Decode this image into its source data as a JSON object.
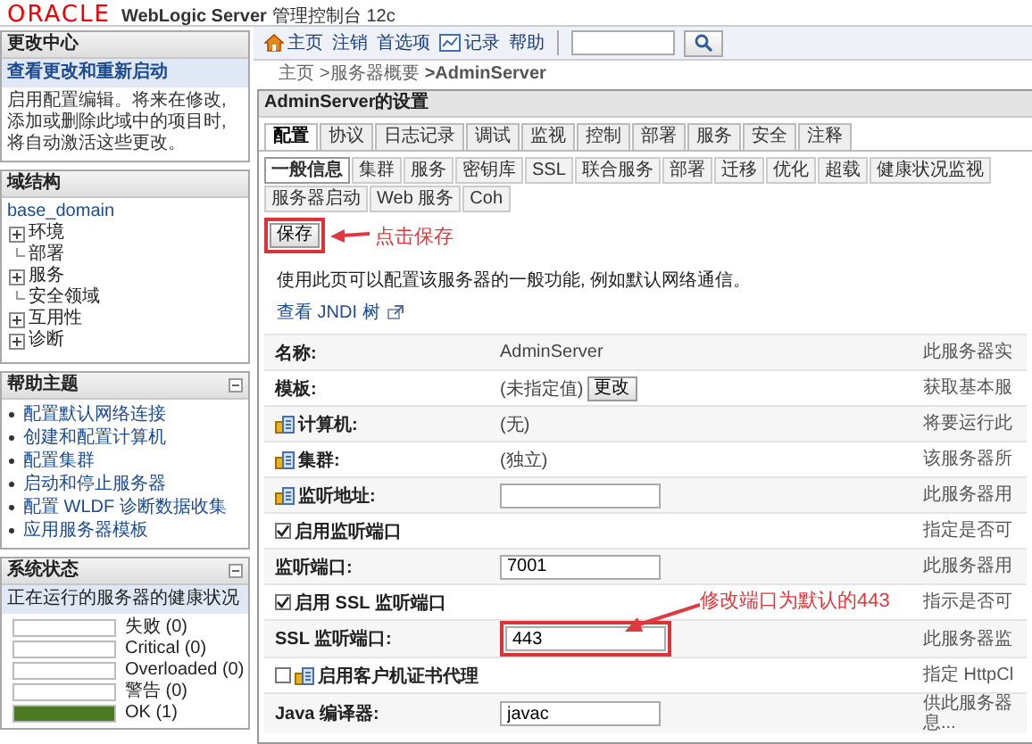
{
  "header": {
    "logo": "ORACLE",
    "product": "WebLogic Server",
    "subtitle": "管理控制台 12c"
  },
  "change_center": {
    "title": "更改中心",
    "link": "查看更改和重新启动",
    "text": "启用配置编辑。将来在修改, 添加或删除此域中的项目时, 将自动激活这些更改。"
  },
  "domain_structure": {
    "title": "域结构",
    "tree": [
      {
        "label": "base_domain",
        "kind": "root",
        "children": [
          {
            "label": "环境",
            "kind": "expandable"
          },
          {
            "label": "部署",
            "kind": "leaf"
          },
          {
            "label": "服务",
            "kind": "expandable"
          },
          {
            "label": "安全领域",
            "kind": "leaf"
          },
          {
            "label": "互用性",
            "kind": "expandable"
          },
          {
            "label": "诊断",
            "kind": "expandable"
          }
        ]
      }
    ]
  },
  "help_topics": {
    "title": "帮助主题",
    "items": [
      "配置默认网络连接",
      "创建和配置计算机",
      "配置集群",
      "启动和停止服务器",
      "配置 WLDF 诊断数据收集",
      "应用服务器模板"
    ]
  },
  "system_status": {
    "title": "系统状态",
    "subtitle": "正在运行的服务器的健康状况",
    "items": [
      {
        "label": "失败 (0)",
        "level": 0
      },
      {
        "label": "Critical (0)",
        "level": 0
      },
      {
        "label": "Overloaded (0)",
        "level": 0
      },
      {
        "label": "警告 (0)",
        "level": 0
      },
      {
        "label": "OK (1)",
        "level": 1
      }
    ]
  },
  "toolbar": {
    "links": [
      {
        "label": "主页",
        "kind": "home"
      },
      {
        "label": "注销",
        "kind": "plain"
      },
      {
        "label": "首选项",
        "kind": "plain"
      },
      {
        "label": "记录",
        "kind": "chart"
      },
      {
        "label": "帮助",
        "kind": "plain"
      }
    ]
  },
  "breadcrumb": [
    {
      "label": "主页",
      "kind": "link"
    },
    {
      "label": ">服务器概要",
      "kind": "link"
    },
    {
      "label": ">AdminServer",
      "kind": "current"
    }
  ],
  "settings": {
    "title": "AdminServer的设置",
    "tabs": [
      {
        "label": "配置",
        "selected": true
      },
      {
        "label": "协议",
        "selected": false
      },
      {
        "label": "日志记录",
        "selected": false
      },
      {
        "label": "调试",
        "selected": false
      },
      {
        "label": "监视",
        "selected": false
      },
      {
        "label": "控制",
        "selected": false
      },
      {
        "label": "部署",
        "selected": false
      },
      {
        "label": "服务",
        "selected": false
      },
      {
        "label": "安全",
        "selected": false
      },
      {
        "label": "注释",
        "selected": false
      }
    ],
    "subtabs": [
      {
        "label": "一般信息",
        "selected": true
      },
      {
        "label": "集群",
        "selected": false
      },
      {
        "label": "服务",
        "selected": false
      },
      {
        "label": "密钥库",
        "selected": false
      },
      {
        "label": "SSL",
        "selected": false
      },
      {
        "label": "联合服务",
        "selected": false
      },
      {
        "label": "部署",
        "selected": false
      },
      {
        "label": "迁移",
        "selected": false
      },
      {
        "label": "优化",
        "selected": false
      },
      {
        "label": "超载",
        "selected": false
      },
      {
        "label": "健康状况监视",
        "selected": false
      },
      {
        "label": "服务器启动",
        "selected": false
      },
      {
        "label": "Web 服务",
        "selected": false
      },
      {
        "label": "Coh",
        "selected": false
      }
    ],
    "save": {
      "label": "保存",
      "highlighted": true,
      "note": "点击保存"
    },
    "intro": "使用此页可以配置该服务器的一般功能, 例如默认网络通信。",
    "jndi_link": "查看 JNDI 树",
    "rows": [
      {
        "kind": "text",
        "label": "名称:",
        "value": "AdminServer",
        "description": "此服务器实",
        "has_icon": false
      },
      {
        "kind": "template",
        "label": "模板:",
        "value": "(未指定值)",
        "button": "更改",
        "description": "获取基本服",
        "has_icon": false
      },
      {
        "kind": "text",
        "label": "计算机:",
        "value": "(无)",
        "description": "将要运行此",
        "has_icon": true
      },
      {
        "kind": "text",
        "label": "集群:",
        "value": "(独立)",
        "description": "该服务器所",
        "has_icon": true
      },
      {
        "kind": "field",
        "label": "监听地址:",
        "value": "",
        "description": "此服务器用",
        "has_icon": true,
        "highlighted": false
      },
      {
        "kind": "checkbox",
        "label": "启用监听端口",
        "checked": true,
        "description": "指定是否可",
        "has_icon": false
      },
      {
        "kind": "field",
        "label": "监听端口:",
        "value": "7001",
        "description": "此服务器用",
        "has_icon": false,
        "highlighted": false
      },
      {
        "kind": "checkbox",
        "label": "启用 SSL 监听端口",
        "checked": true,
        "description": "指示是否可",
        "has_icon": false
      },
      {
        "kind": "field",
        "label": "SSL 监听端口:",
        "value": "443",
        "description": "此服务器监",
        "has_icon": false,
        "highlighted": true,
        "note": "修改端口为默认的443"
      },
      {
        "kind": "checkbox",
        "label": "启用客户机证书代理",
        "checked": false,
        "description": "指定 HttpCl",
        "has_icon": true
      },
      {
        "kind": "field",
        "label": "Java 编译器:",
        "value": "javac",
        "description": "供此服务器息...",
        "has_icon": false,
        "highlighted": false
      }
    ]
  }
}
